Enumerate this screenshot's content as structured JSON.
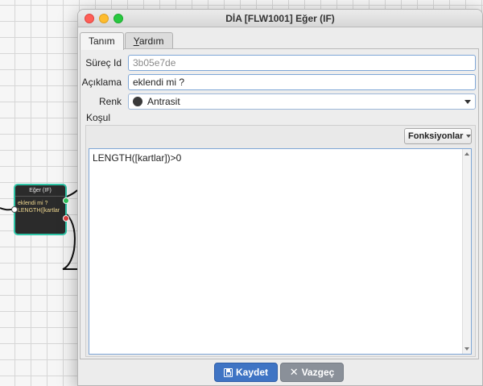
{
  "node": {
    "title": "Eğer (IF)",
    "line1": "eklendi mi ?",
    "line2": "LENGTH([kartlar"
  },
  "dialog": {
    "title": "DİA [FLW1001] Eğer (IF)",
    "tabs": [
      {
        "label": "Tanım",
        "active": true
      },
      {
        "label": "Yardım",
        "mnemonic": "Y",
        "rest": "ardım",
        "active": false
      }
    ],
    "fields": {
      "process_id_label": "Süreç Id",
      "process_id_placeholder": "3b05e7de",
      "description_label": "Açıklama",
      "description_value": "eklendi mi ?",
      "color_label": "Renk",
      "color_value": "Antrasit",
      "color_hex": "#3a3a3a"
    },
    "condition": {
      "label": "Koşul",
      "functions_button": "Fonksiyonlar",
      "code": "LENGTH([kartlar])>0"
    },
    "buttons": {
      "save": "Kaydet",
      "cancel": "Vazgeç"
    }
  },
  "colors": {
    "accent": "#3f74c4",
    "node_border": "#2ec4a6",
    "port_true": "#2ec45a",
    "port_false": "#e04040"
  }
}
